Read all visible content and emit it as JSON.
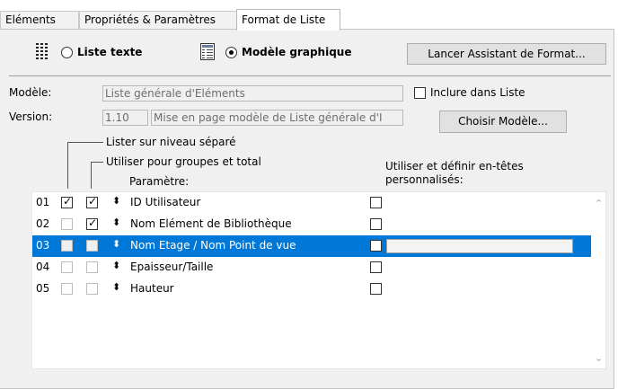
{
  "tabs": [
    {
      "label": "Eléments"
    },
    {
      "label": "Propriétés & Paramètres"
    },
    {
      "label": "Format de Liste"
    }
  ],
  "toolbar": {
    "liste_texte_label": "Liste texte",
    "modele_graphique_label": "Modèle graphique",
    "assistant_button": "Lancer Assistant de Format...",
    "selected_mode": "Modèle graphique"
  },
  "modele": {
    "label": "Modèle:",
    "value": "Liste générale d'Eléments",
    "inclure_label": "Inclure dans Liste"
  },
  "version": {
    "label": "Version:",
    "number": "1.10",
    "description": "Mise en page modèle de Liste générale d'I",
    "choose_button": "Choisir Modèle..."
  },
  "headers": {
    "lister_niveau": "Lister sur niveau séparé",
    "utiliser_groupes": "Utiliser pour groupes et total",
    "parametre": "Paramètre:",
    "entetes": "Utiliser et définir en-têtes personnalisés:"
  },
  "rows": [
    {
      "num": "01",
      "name": "ID Utilisateur",
      "niveau": true,
      "groupes": true
    },
    {
      "num": "02",
      "name": "Nom Elément de Bibliothèque",
      "niveau": false,
      "groupes": true
    },
    {
      "num": "03",
      "name": "Nom Etage / Nom Point de vue",
      "niveau": false,
      "groupes": false
    },
    {
      "num": "04",
      "name": "Epaisseur/Taille",
      "niveau": false,
      "groupes": false
    },
    {
      "num": "05",
      "name": "Hauteur",
      "niveau": false,
      "groupes": false
    }
  ],
  "selected_row": "03",
  "colors": {
    "selection": "#0078d7",
    "pane": "#f0f0f0"
  }
}
